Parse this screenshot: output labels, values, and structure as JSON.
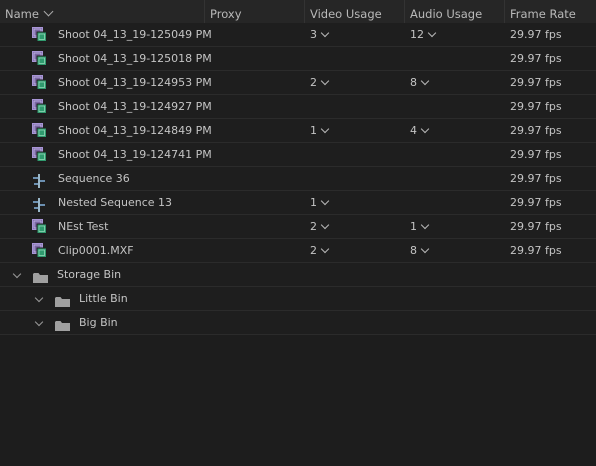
{
  "columns": {
    "name": "Name",
    "proxy": "Proxy",
    "video_usage": "Video Usage",
    "audio_usage": "Audio Usage",
    "frame_rate": "Frame Rate"
  },
  "items": [
    {
      "name": "Shoot 04_13_19-125049 PM",
      "type": "clip",
      "video": "3",
      "audio": "12",
      "fps": "29.97 fps"
    },
    {
      "name": "Shoot 04_13_19-125018 PM",
      "type": "clip",
      "video": "",
      "audio": "",
      "fps": "29.97 fps"
    },
    {
      "name": "Shoot 04_13_19-124953 PM",
      "type": "clip",
      "video": "2",
      "audio": "8",
      "fps": "29.97 fps"
    },
    {
      "name": "Shoot 04_13_19-124927 PM",
      "type": "clip",
      "video": "",
      "audio": "",
      "fps": "29.97 fps"
    },
    {
      "name": "Shoot 04_13_19-124849 PM",
      "type": "clip",
      "video": "1",
      "audio": "4",
      "fps": "29.97 fps"
    },
    {
      "name": "Shoot 04_13_19-124741 PM",
      "type": "clip",
      "video": "",
      "audio": "",
      "fps": "29.97 fps"
    },
    {
      "name": "Sequence 36",
      "type": "sequence",
      "video": "",
      "audio": "",
      "fps": "29.97 fps"
    },
    {
      "name": "Nested Sequence 13",
      "type": "sequence",
      "video": "1",
      "audio": "",
      "fps": "29.97 fps"
    },
    {
      "name": "NEst Test",
      "type": "clip",
      "video": "2",
      "audio": "1",
      "fps": "29.97 fps"
    },
    {
      "name": "Clip0001.MXF",
      "type": "clip",
      "video": "2",
      "audio": "8",
      "fps": "29.97 fps"
    }
  ],
  "bins": [
    {
      "name": "Storage Bin",
      "level": 0
    },
    {
      "name": "Little Bin",
      "level": 1
    },
    {
      "name": "Big Bin",
      "level": 1
    }
  ]
}
